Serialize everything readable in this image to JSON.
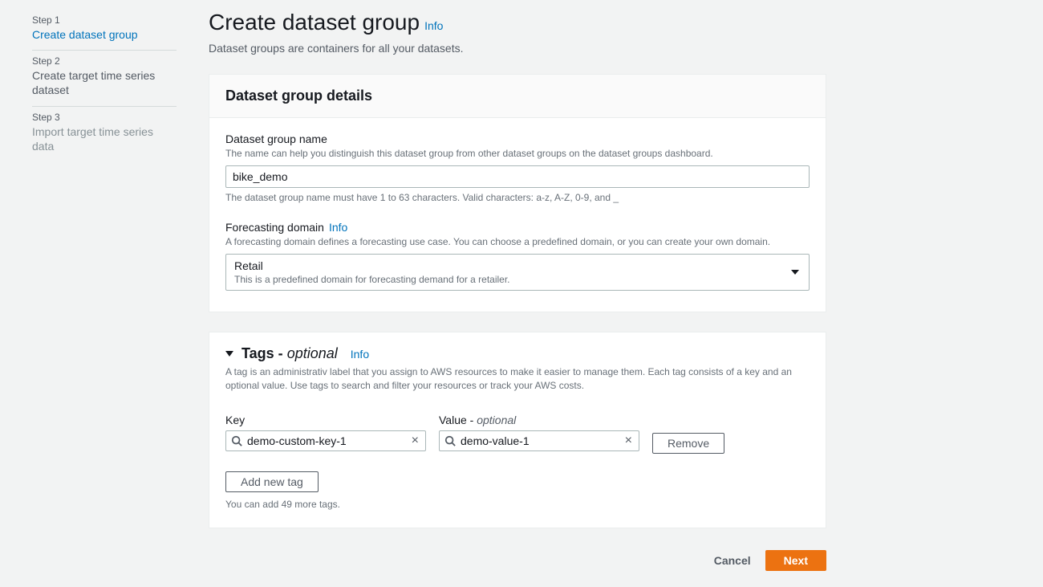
{
  "wizard": {
    "steps": [
      {
        "label": "Step 1",
        "title": "Create dataset group"
      },
      {
        "label": "Step 2",
        "title": "Create target time series dataset"
      },
      {
        "label": "Step 3",
        "title": "Import target time series data"
      }
    ]
  },
  "header": {
    "title": "Create dataset group",
    "info": "Info",
    "desc": "Dataset groups are containers for all your datasets."
  },
  "details": {
    "panel_title": "Dataset group details",
    "name_label": "Dataset group name",
    "name_help": "The name can help you distinguish this dataset group from other dataset groups on the dataset groups dashboard.",
    "name_value": "bike_demo",
    "name_constraint": "The dataset group name must have 1 to 63 characters. Valid characters: a-z, A-Z, 0-9, and _",
    "domain_label": "Forecasting domain",
    "domain_info": "Info",
    "domain_help": "A forecasting domain defines a forecasting use case. You can choose a predefined domain, or you can create your own domain.",
    "domain_value": "Retail",
    "domain_sub": "This is a predefined domain for forecasting demand for a retailer."
  },
  "tags": {
    "title_prefix": "Tags -",
    "title_suffix": "optional",
    "info": "Info",
    "desc": "A tag is an administrativ label that you assign to AWS resources to make it easier to manage them. Each tag consists of a key and an optional value. Use tags to search and filter your resources or track your AWS costs.",
    "key_label": "Key",
    "value_label_prefix": "Value -",
    "value_label_suffix": "optional",
    "rows": [
      {
        "key": "demo-custom-key-1",
        "value": "demo-value-1"
      }
    ],
    "remove": "Remove",
    "add_new": "Add new tag",
    "limit": "You can add 49 more tags."
  },
  "actions": {
    "cancel": "Cancel",
    "next": "Next"
  }
}
